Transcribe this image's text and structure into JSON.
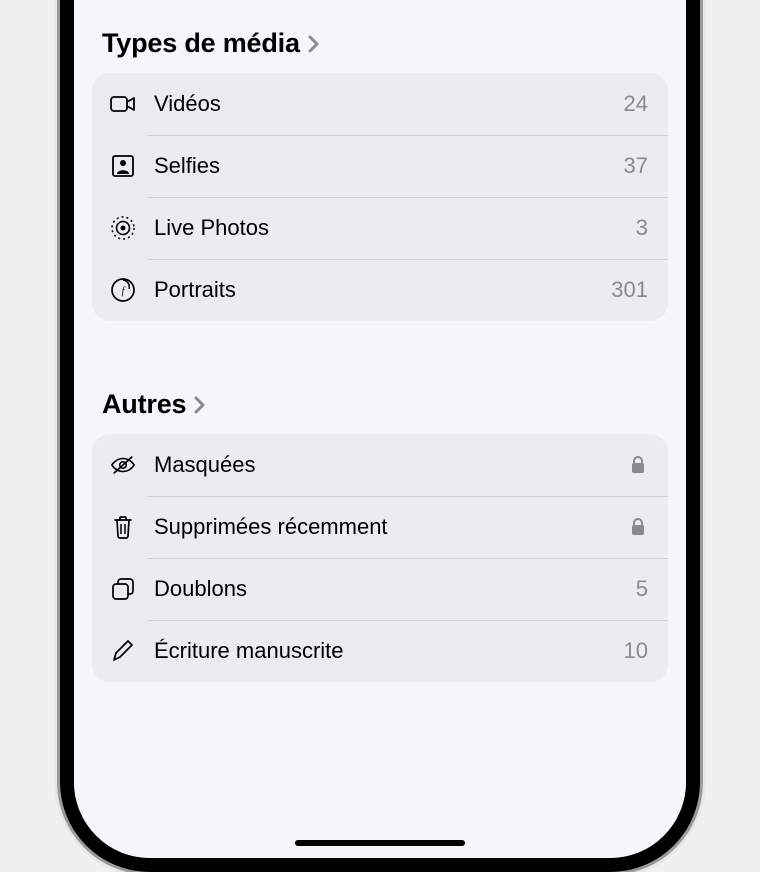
{
  "sections": {
    "media": {
      "title": "Types de média",
      "items": [
        {
          "label": "Vidéos",
          "count": "24"
        },
        {
          "label": "Selfies",
          "count": "37"
        },
        {
          "label": "Live Photos",
          "count": "3"
        },
        {
          "label": "Portraits",
          "count": "301"
        }
      ]
    },
    "others": {
      "title": "Autres",
      "items": [
        {
          "label": "Masquées",
          "locked": true
        },
        {
          "label": "Supprimées récemment",
          "locked": true
        },
        {
          "label": "Doublons",
          "count": "5"
        },
        {
          "label": "Écriture manuscrite",
          "count": "10"
        }
      ]
    }
  }
}
